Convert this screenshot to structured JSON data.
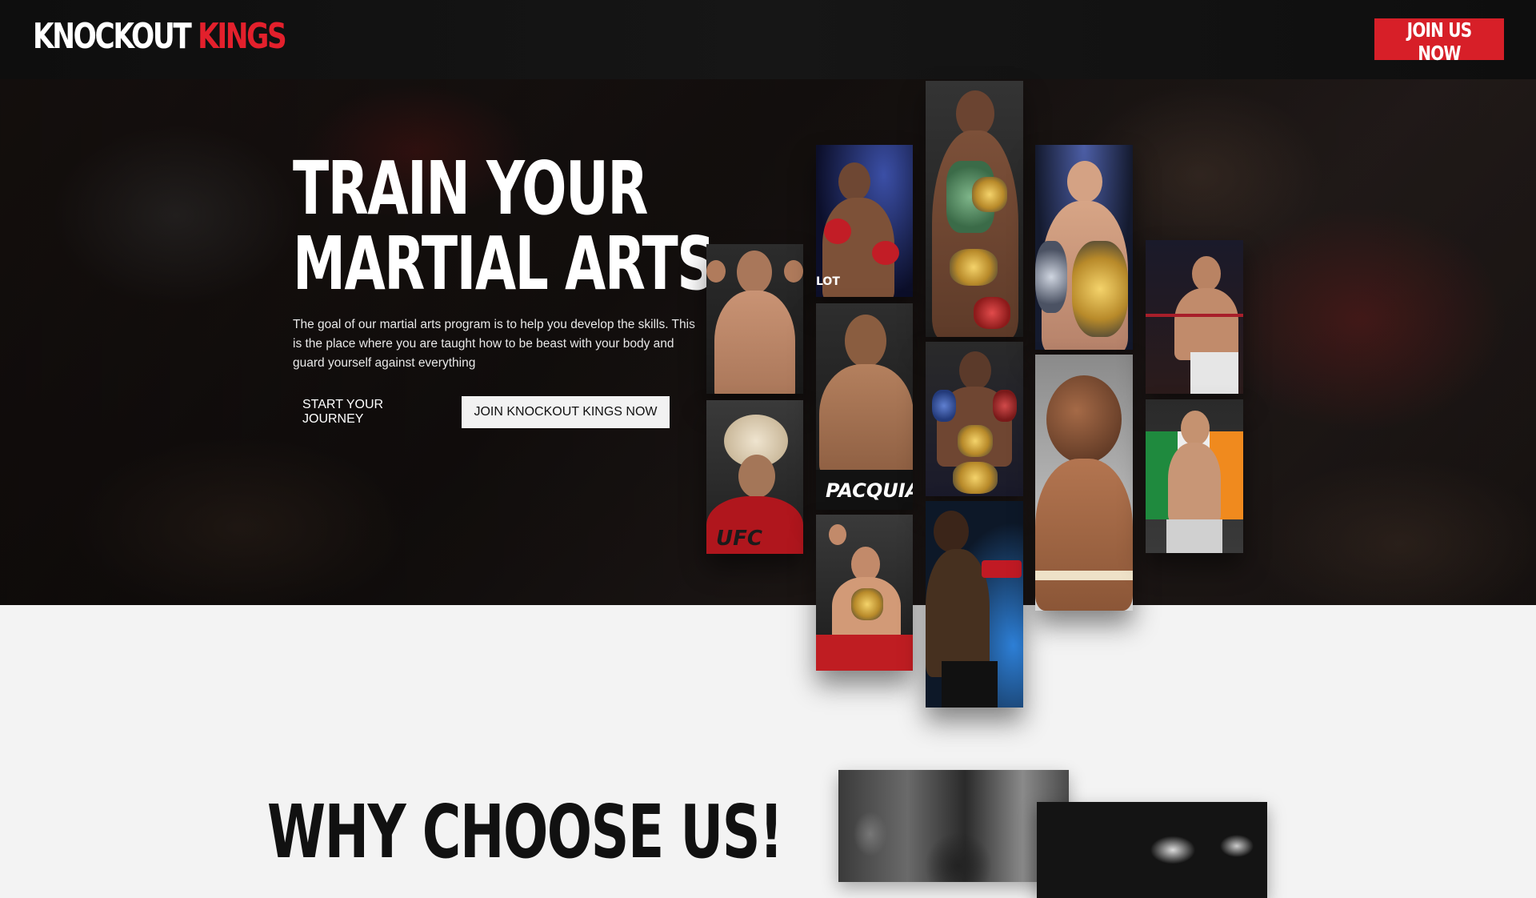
{
  "nav": {
    "logo_main": "KNOCKOUT",
    "logo_accent": "KINGS",
    "cta_label": "JOIN US NOW"
  },
  "hero": {
    "title_line1": "TRAIN YOUR",
    "title_line2": "MARTIAL ARTS",
    "description": "The goal of our martial arts program is to help you develop the skills. This is the place where you are taught how to be beast with your body and guard yourself against everything",
    "btn_secondary": "START YOUR JOURNEY",
    "btn_primary": "JOIN KNOCKOUT KINGS NOW"
  },
  "gallery": {
    "caption_pacquiao": "PACQUIAO",
    "caption_ufc": "UFC",
    "caption_slot": "LOT"
  },
  "why": {
    "title": "WHY CHOOSE US!"
  },
  "colors": {
    "accent": "#d71f28",
    "nav_bg": "#121212",
    "page_bg": "#f3f3f3"
  }
}
